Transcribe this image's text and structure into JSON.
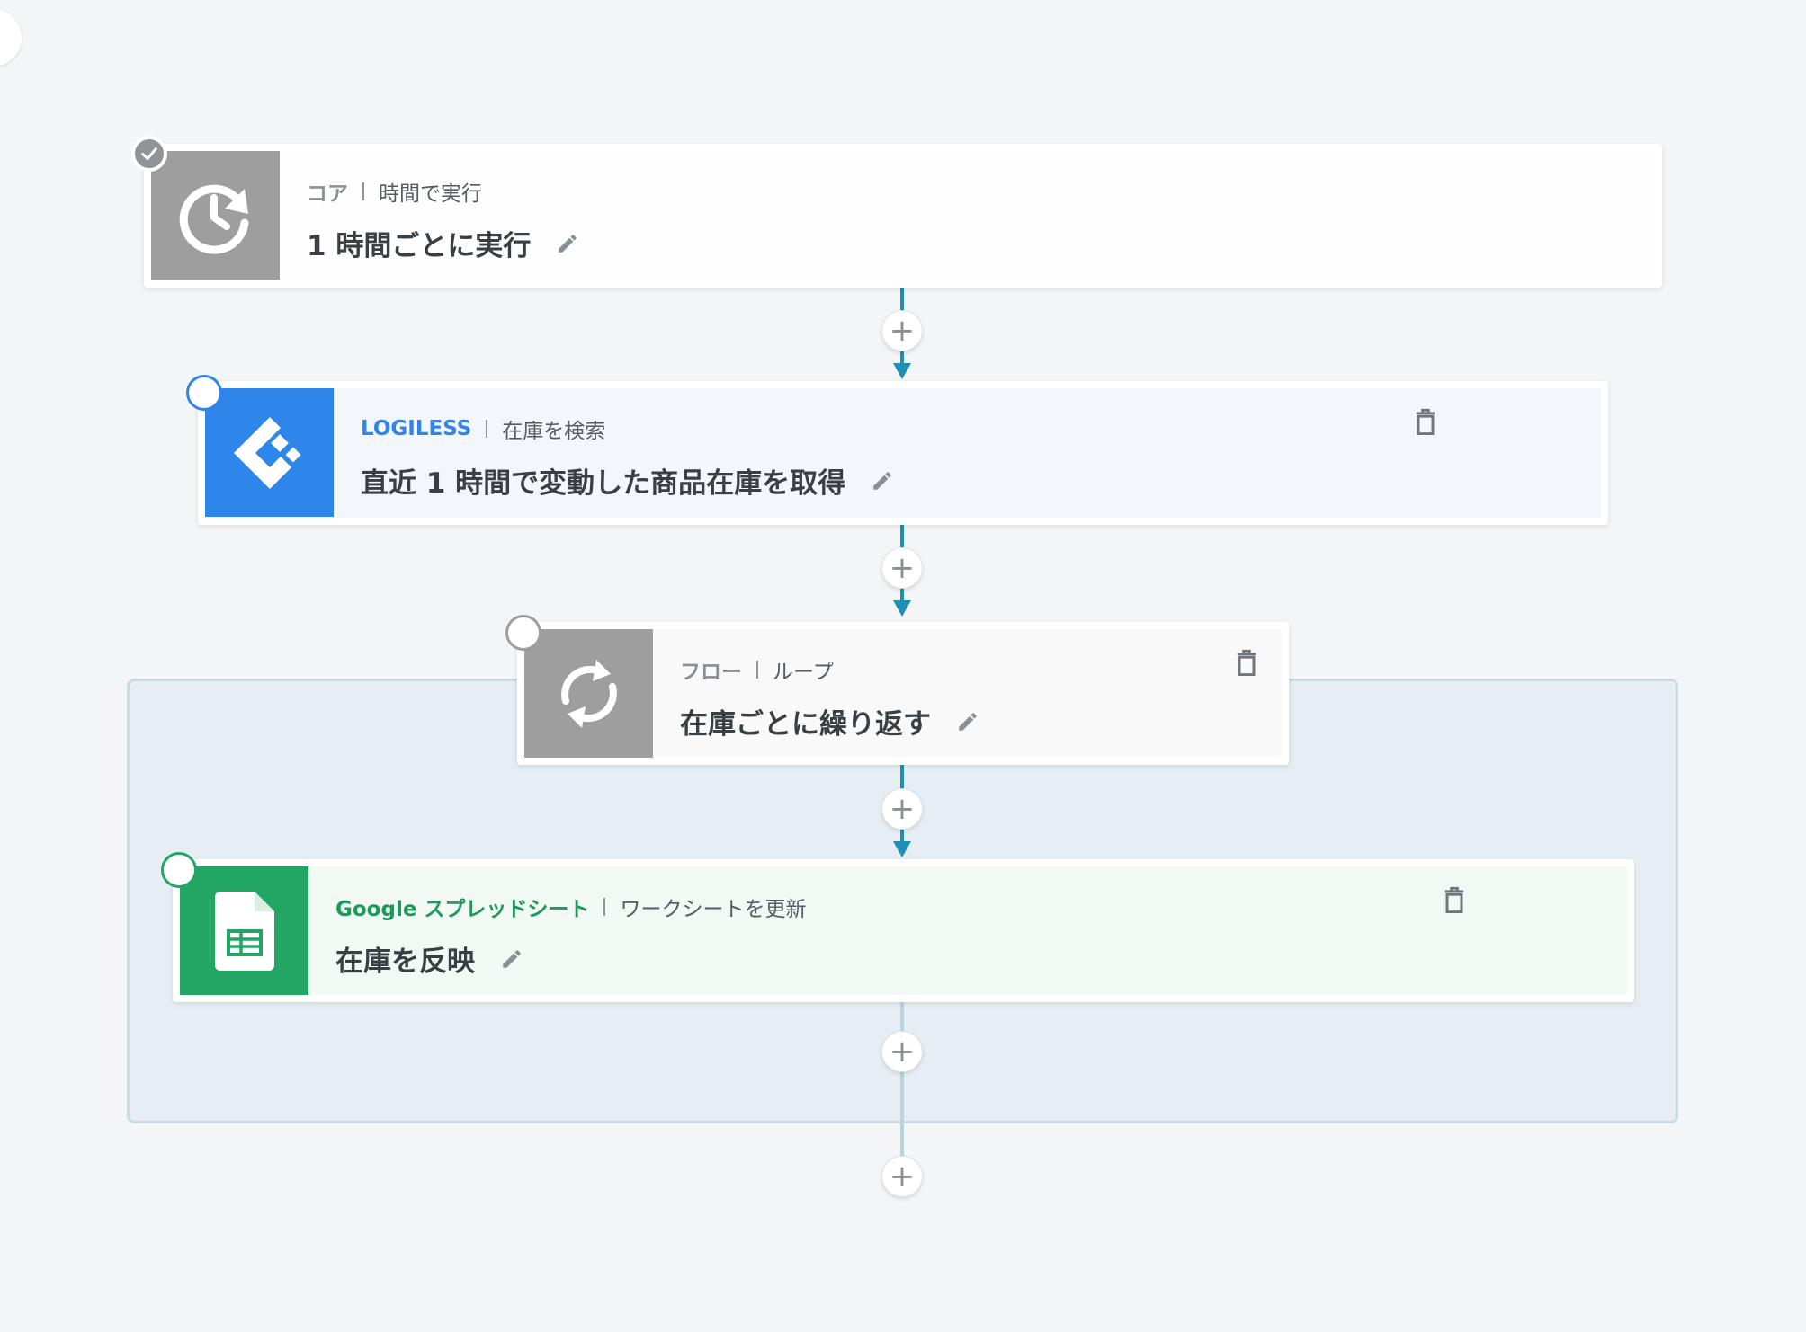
{
  "steps": [
    {
      "service": "コア",
      "action": "時間で実行",
      "title": "1 時間ごとに実行",
      "icon": "clock-refresh-icon",
      "tile_color": "#9e9e9e",
      "status": "completed"
    },
    {
      "service": "LOGILESS",
      "action": "在庫を検索",
      "title": "直近 1 時間で変動した商品在庫を取得",
      "icon": "logiless-logo-icon",
      "tile_color": "#2f86ea",
      "service_color": "#2f86ea",
      "status": "pending"
    },
    {
      "service": "フロー",
      "action": "ループ",
      "title": "在庫ごとに繰り返す",
      "icon": "loop-icon",
      "tile_color": "#9e9e9e",
      "status": "pending"
    },
    {
      "service": "Google スプレッドシート",
      "action": "ワークシートを更新",
      "title": "在庫を反映",
      "icon": "google-sheets-icon",
      "tile_color": "#23a564",
      "service_color": "#1d9a5a",
      "status": "pending"
    }
  ],
  "add_step_symbol": "+"
}
